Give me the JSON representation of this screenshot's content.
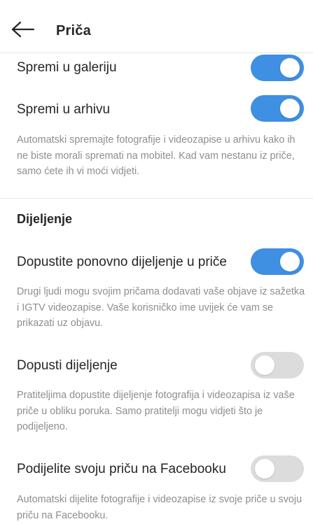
{
  "header": {
    "title": "Priča",
    "back_icon": "arrow-left-icon"
  },
  "settings": {
    "save_gallery": {
      "label": "Spremi u galeriju",
      "enabled": true
    },
    "save_archive": {
      "label": "Spremi u arhivu",
      "enabled": true,
      "description": "Automatski spremajte fotografije i videozapise u arhivu kako ih ne biste morali spremati na mobitel. Kad vam nestanu iz priče, samo ćete ih vi moći vidjeti."
    }
  },
  "sharing": {
    "title": "Dijeljenje",
    "reshare": {
      "label": "Dopustite ponovno dijeljenje u priče",
      "enabled": true,
      "description": "Drugi ljudi mogu svojim pričama dodavati vaše objave iz sažetka i IGTV videozapise. Vaše korisničko ime uvijek će vam se prikazati uz objavu."
    },
    "allow_sharing": {
      "label": "Dopusti dijeljenje",
      "enabled": false,
      "description": "Pratiteljima dopustite dijeljenje fotografija i videozapisa iz vaše priče u obliku poruka. Samo pratitelji mogu vidjeti što je podijeljeno."
    },
    "facebook": {
      "label": "Podijelite svoju priču na Facebooku",
      "enabled": false,
      "description": "Automatski dijelite fotografije i videozapise iz svoje priče u svoju priču na Facebooku."
    }
  },
  "colors": {
    "toggle_on": "#3f8fe3",
    "toggle_off": "#dcdcdc",
    "text_primary": "#262626",
    "text_secondary": "#8e8e8e"
  }
}
